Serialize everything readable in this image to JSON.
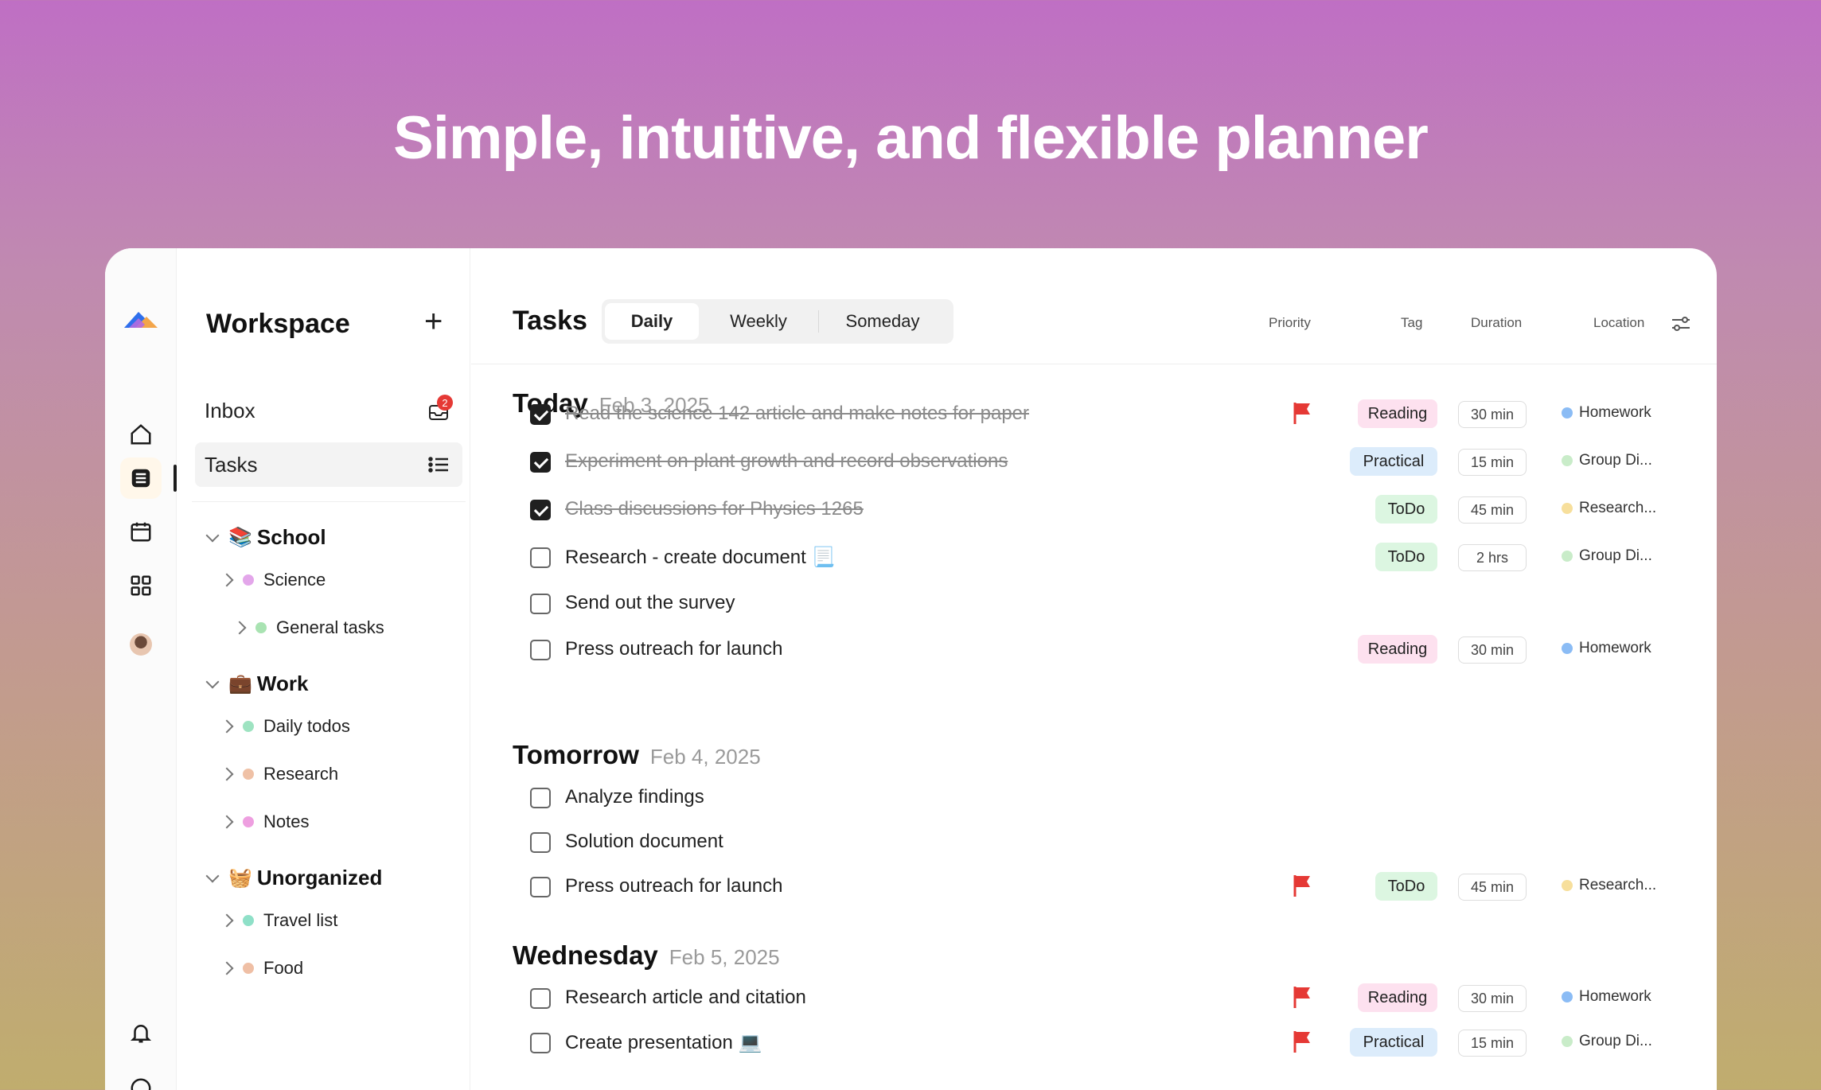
{
  "headline": "Simple, intuitive, and flexible planner",
  "colors": {
    "reading_tag": "#fde1ef",
    "practical_tag": "#dcecfb",
    "todo_tag": "#dcf6e1",
    "flag": "#e53935",
    "homework_dot": "#8bbcf5",
    "group_dot": "#c9ecc9",
    "research_dot": "#f7df9c"
  },
  "sidebar": {
    "title": "Workspace",
    "add_label": "+",
    "inbox": {
      "label": "Inbox",
      "badge": "2"
    },
    "tasks": {
      "label": "Tasks"
    },
    "groups": [
      {
        "emoji": "📚",
        "label": "School",
        "items": [
          {
            "label": "Science",
            "color": "#e3a6ea"
          },
          {
            "label": "General tasks",
            "color": "#a9e3b2"
          }
        ]
      },
      {
        "emoji": "💼",
        "label": "Work",
        "items": [
          {
            "label": "Daily todos",
            "color": "#9ee3c1"
          },
          {
            "label": "Research",
            "color": "#efc1a6"
          },
          {
            "label": "Notes",
            "color": "#ee9fe0"
          }
        ]
      },
      {
        "emoji": "🧺",
        "label": "Unorganized",
        "items": [
          {
            "label": "Travel list",
            "color": "#8fe0c8"
          },
          {
            "label": "Food",
            "color": "#efbfa5"
          }
        ]
      }
    ]
  },
  "main": {
    "title": "Tasks",
    "views": [
      "Daily",
      "Weekly",
      "Someday"
    ],
    "active_view": "Daily",
    "columns": {
      "priority": "Priority",
      "tag": "Tag",
      "duration": "Duration",
      "location": "Location"
    },
    "sections": [
      {
        "name": "Today",
        "date": "Feb 3, 2025",
        "tasks": [
          {
            "title": "Read the science 142 article and make notes for paper",
            "done": true,
            "flag": true,
            "tag": "Reading",
            "duration": "30 min",
            "location": "Homework"
          },
          {
            "title": "Experiment on plant growth and record observations",
            "done": true,
            "flag": false,
            "tag": "Practical",
            "duration": "15 min",
            "location": "Group Di..."
          },
          {
            "title": "Class discussions for Physics 1265",
            "done": true,
            "flag": false,
            "tag": "ToDo",
            "duration": "45 min",
            "location": "Research..."
          },
          {
            "title": "Research - create document 📃",
            "done": false,
            "flag": false,
            "tag": "ToDo",
            "duration": "2 hrs",
            "location": "Group Di..."
          },
          {
            "title": "Send out the survey",
            "done": false,
            "flag": false,
            "tag": "",
            "duration": "",
            "location": ""
          },
          {
            "title": "Press outreach for launch",
            "done": false,
            "flag": false,
            "tag": "Reading",
            "duration": "30 min",
            "location": "Homework"
          }
        ]
      },
      {
        "name": "Tomorrow",
        "date": "Feb 4, 2025",
        "tasks": [
          {
            "title": "Analyze findings",
            "done": false,
            "flag": false,
            "tag": "",
            "duration": "",
            "location": ""
          },
          {
            "title": "Solution document",
            "done": false,
            "flag": false,
            "tag": "",
            "duration": "",
            "location": ""
          },
          {
            "title": "Press outreach for launch",
            "done": false,
            "flag": true,
            "tag": "ToDo",
            "duration": "45 min",
            "location": "Research..."
          }
        ]
      },
      {
        "name": "Wednesday",
        "date": "Feb 5, 2025",
        "tasks": [
          {
            "title": "Research article and citation",
            "done": false,
            "flag": true,
            "tag": "Reading",
            "duration": "30 min",
            "location": "Homework"
          },
          {
            "title": "Create presentation 💻",
            "done": false,
            "flag": true,
            "tag": "Practical",
            "duration": "15 min",
            "location": "Group Di..."
          }
        ]
      }
    ]
  }
}
